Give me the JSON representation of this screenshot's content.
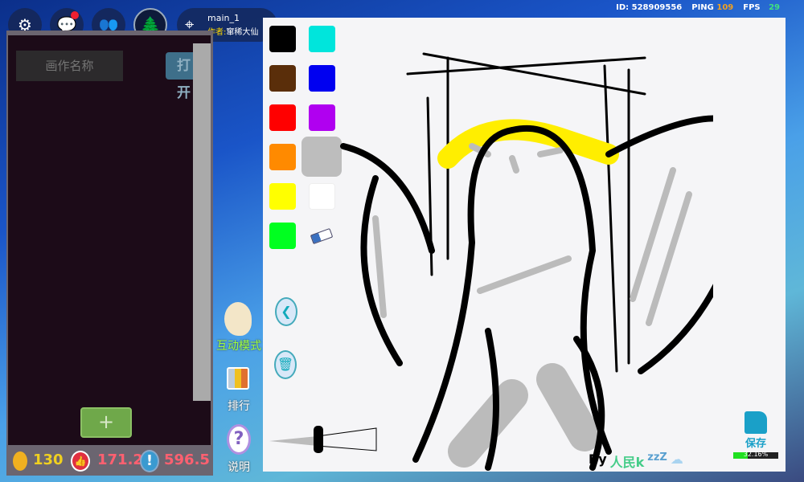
{
  "topbar": {
    "map_name": "main_1",
    "author_label": "作者:",
    "author_name": "窜稀大仙",
    "id_text": "ID: 528909556",
    "ping_label": "PING",
    "ping_value": "109",
    "fps_label": "FPS",
    "fps_value": "29"
  },
  "panel": {
    "name_placeholder": "画作名称",
    "open_label": "打开",
    "add_label": "+",
    "coins": "130",
    "likes": "171.2",
    "score": "596.5"
  },
  "side": {
    "interactive_mode": "互动模式",
    "ranking": "排行",
    "help": "说明",
    "help_glyph": "?"
  },
  "palette": {
    "colors": [
      "#000000",
      "#00e5dc",
      "#5a2e0a",
      "#0000f0",
      "#ff0000",
      "#b000f0",
      "#ff8a00",
      "#bdbdbd",
      "#ffff00",
      "#ffffff",
      "#00ff20"
    ]
  },
  "canvas": {
    "signature_by": "By",
    "signature_name": "人民k",
    "signature_z": "zzZ",
    "save_label": "保存",
    "progress_text": "32.16%",
    "progress": 0.3216
  }
}
